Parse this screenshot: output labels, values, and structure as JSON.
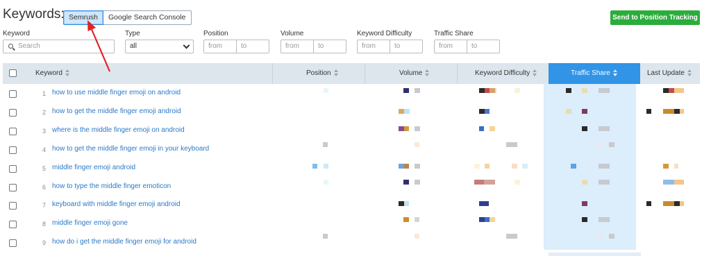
{
  "header": {
    "title": "Keywords:",
    "source_options": [
      {
        "label": "Semrush",
        "active": true
      },
      {
        "label": "Google Search Console",
        "active": false
      }
    ],
    "send_button_label": "Send to Position Tracking"
  },
  "filters": {
    "keyword": {
      "label": "Keyword",
      "placeholder": "Search"
    },
    "type": {
      "label": "Type",
      "value": "all"
    },
    "position": {
      "label": "Position",
      "from": "from",
      "to": "to"
    },
    "volume": {
      "label": "Volume",
      "from": "from",
      "to": "to"
    },
    "difficulty": {
      "label": "Keyword Difficulty",
      "from": "from",
      "to": "to"
    },
    "traffic_share": {
      "label": "Traffic Share",
      "from": "from",
      "to": "to"
    }
  },
  "table": {
    "columns": {
      "keyword": "Keyword",
      "position": "Position",
      "volume": "Volume",
      "difficulty": "Keyword Difficulty",
      "traffic_share": "Traffic Share",
      "last_update": "Last Update"
    },
    "sorted_column": "traffic_share",
    "rows": [
      {
        "num": "1",
        "keyword": "how to use middle finger emoji on android"
      },
      {
        "num": "2",
        "keyword": "how to get the middle finger emoji android"
      },
      {
        "num": "3",
        "keyword": "where is the middle finger emoji on android"
      },
      {
        "num": "4",
        "keyword": "how to get the middle finger emoji in your keyboard"
      },
      {
        "num": "5",
        "keyword": "middle finger emoji android"
      },
      {
        "num": "6",
        "keyword": "how to type the middle finger emoticon"
      },
      {
        "num": "7",
        "keyword": "keyboard with middle finger emoji android"
      },
      {
        "num": "8",
        "keyword": "middle finger emoji gone"
      },
      {
        "num": "9",
        "keyword": "how do i get the middle finger emoji for android"
      }
    ]
  },
  "colors": {
    "accent": "#3194e6",
    "send_button": "#2bad3c",
    "link": "#2c79c8",
    "annotation_arrow": "#e32222"
  }
}
